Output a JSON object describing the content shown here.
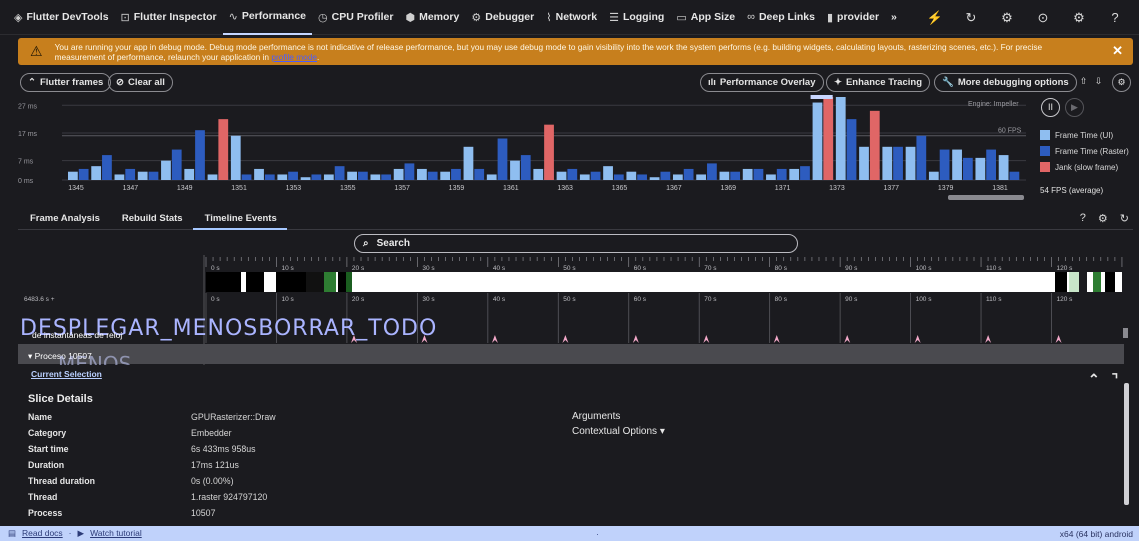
{
  "topbar": {
    "tabs": [
      {
        "icon": "◈",
        "label": "Flutter DevTools"
      },
      {
        "icon": "⊡",
        "label": "Flutter Inspector"
      },
      {
        "icon": "∿",
        "label": "Performance"
      },
      {
        "icon": "◷",
        "label": "CPU Profiler"
      },
      {
        "icon": "⬢",
        "label": "Memory"
      },
      {
        "icon": "⚙",
        "label": "Debugger"
      },
      {
        "icon": "⌇",
        "label": "Network"
      },
      {
        "icon": "☰",
        "label": "Logging"
      },
      {
        "icon": "▭",
        "label": "App Size"
      },
      {
        "icon": "∞",
        "label": "Deep Links"
      },
      {
        "icon": "▮",
        "label": "provider"
      }
    ],
    "overflow_label": "»",
    "right_icons": [
      "⚡",
      "↻",
      "⚙",
      "⊙",
      "⚙",
      "?"
    ]
  },
  "banner": {
    "message": "You are running your app in debug mode. Debug mode performance is not indicative of release performance, but you may use debug mode to gain visibility into the work the system performs (e.g. building widgets, calculating layouts, rasterizing scenes, etc.). For precise measurement of performance, relaunch your application in",
    "link": "profile mode",
    "suffix": ".",
    "close": "✕"
  },
  "controls": {
    "flutter_frames": "Flutter frames",
    "clear_all": "Clear all",
    "performance_overlay": "Performance Overlay",
    "enhance_tracing": "Enhance Tracing",
    "more_debugging": "More debugging options"
  },
  "chart_data": {
    "type": "bar",
    "engine_label": "Engine: Impeller",
    "fps_line_label": "60 FPS",
    "y_ticks": [
      "27 ms",
      "17 ms",
      "7 ms",
      "0 ms"
    ],
    "x_ticks": [
      "1345",
      "1347",
      "1349",
      "1351",
      "1353",
      "1355",
      "1357",
      "1359",
      "1361",
      "1363",
      "1365",
      "1367",
      "1369",
      "1371",
      "1373",
      "1377",
      "1379",
      "1381"
    ],
    "ylim": [
      0,
      30
    ],
    "series": [
      {
        "name": "Frame Time (UI)",
        "color": "#8fbef0",
        "values": [
          3,
          5,
          2,
          3,
          7,
          4,
          2,
          16,
          4,
          2,
          1,
          2,
          3,
          2,
          4,
          4,
          3,
          12,
          2,
          7,
          4,
          3,
          2,
          5,
          3,
          1,
          2,
          2,
          3,
          4,
          2,
          4,
          28,
          30,
          12,
          12,
          12,
          3,
          11,
          8,
          9
        ]
      },
      {
        "name": "Frame Time (Raster)",
        "color": "#2d5cbf",
        "values": [
          4,
          9,
          4,
          3,
          11,
          18,
          3,
          2,
          2,
          3,
          2,
          5,
          3,
          2,
          6,
          3,
          4,
          4,
          15,
          9,
          4,
          4,
          3,
          2,
          2,
          3,
          4,
          6,
          3,
          4,
          4,
          5,
          28,
          22,
          4,
          12,
          16,
          11,
          8,
          11,
          3
        ]
      },
      {
        "name": "Jank (slow frame)",
        "color": "#e06666",
        "values": [
          0,
          0,
          0,
          0,
          0,
          0,
          22,
          0,
          0,
          0,
          0,
          0,
          0,
          0,
          0,
          0,
          0,
          0,
          0,
          0,
          20,
          0,
          0,
          0,
          0,
          0,
          0,
          0,
          0,
          0,
          0,
          0,
          30,
          0,
          25,
          0,
          0,
          0,
          0,
          0,
          0
        ]
      }
    ],
    "average_label": "54 FPS (average)"
  },
  "subtabs": [
    "Frame Analysis",
    "Rebuild Stats",
    "Timeline Events"
  ],
  "search": {
    "label": "Search"
  },
  "timeline": {
    "ruler_labels": [
      "0 s",
      "10 s",
      "20 s",
      "30 s",
      "40 s",
      "50 s",
      "60 s",
      "70 s",
      "80 s",
      "90 s",
      "100 s",
      "110 s",
      "120 s"
    ],
    "time_offset": "6483.6 s +",
    "overlay_text": "DESPLEGAR_MENOSBORRAR_TODO",
    "snapshot_label": "de instantáneas de reloj",
    "process_label": "Proceso 10507",
    "process_ghost": "MENOS"
  },
  "selection": {
    "tab_label": "Current Selection",
    "title": "Slice Details",
    "rows": [
      {
        "k": "Name",
        "v": "GPURasterizer::Draw"
      },
      {
        "k": "Category",
        "v": "Embedder"
      },
      {
        "k": "Start time",
        "v": "6s 433ms 958us"
      },
      {
        "k": "Duration",
        "v": "17ms 121us"
      },
      {
        "k": "Thread duration",
        "v": "0s (0.00%)"
      },
      {
        "k": "Thread",
        "v": "1.raster 924797120"
      },
      {
        "k": "Process",
        "v": "10507"
      }
    ],
    "arguments": "Arguments",
    "contextual_options": "Contextual Options"
  },
  "footer": {
    "read_docs": "Read docs",
    "watch_tutorial": "Watch tutorial",
    "platform": "x64 (64 bit) android"
  }
}
